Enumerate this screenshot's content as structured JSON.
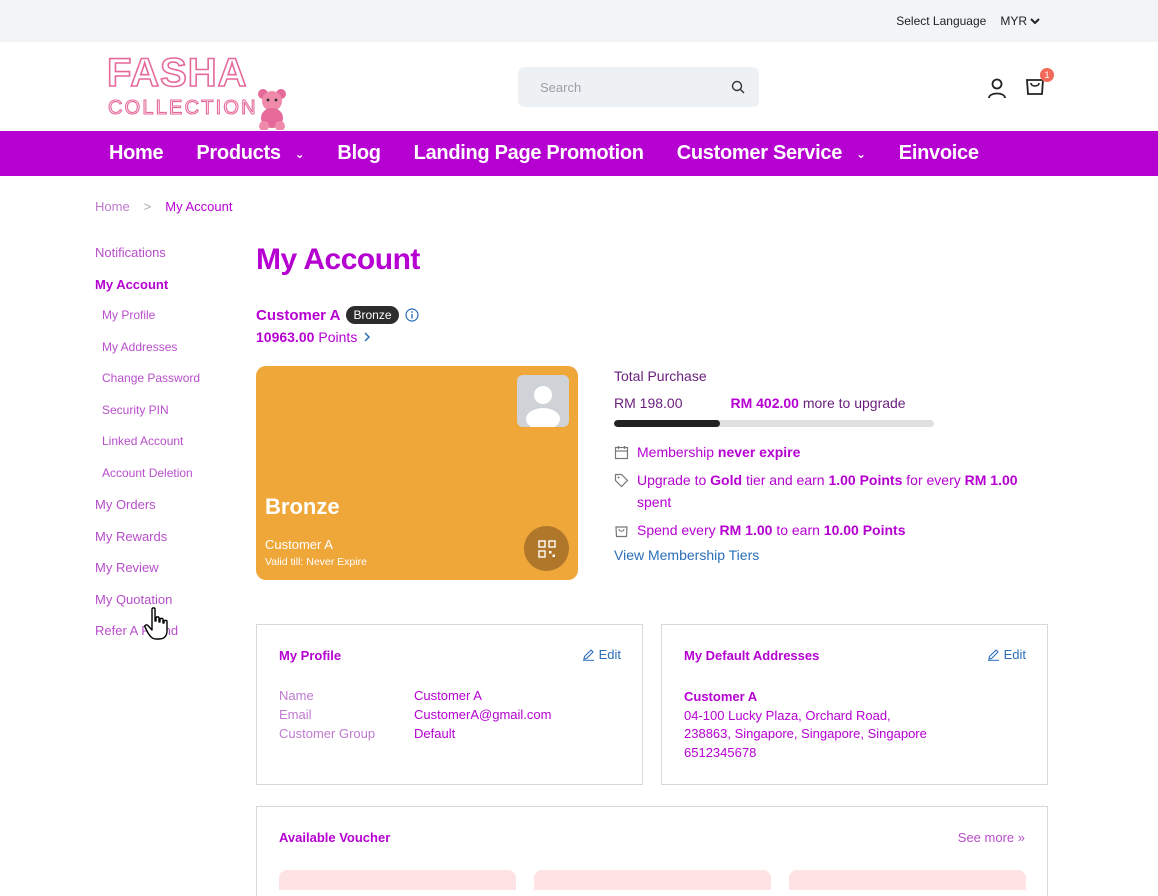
{
  "topbar": {
    "language_label": "Select Language",
    "currency": "MYR"
  },
  "header": {
    "logo_text_top": "FASHA",
    "logo_text_bottom": "COLLECTION",
    "search_placeholder": "Search",
    "cart_count": "1"
  },
  "nav": {
    "items": [
      {
        "label": "Home"
      },
      {
        "label": "Products"
      },
      {
        "label": "Blog"
      },
      {
        "label": "Landing Page Promotion"
      },
      {
        "label": "Customer Service"
      },
      {
        "label": "Einvoice"
      }
    ]
  },
  "breadcrumb": {
    "home": "Home",
    "separator": ">",
    "current": "My Account"
  },
  "sidebar": {
    "items": [
      {
        "label": "Notifications"
      },
      {
        "label": "My Account"
      },
      {
        "label": "My Profile"
      },
      {
        "label": "My Addresses"
      },
      {
        "label": "Change Password"
      },
      {
        "label": "Security PIN"
      },
      {
        "label": "Linked Account"
      },
      {
        "label": "Account Deletion"
      },
      {
        "label": "My Orders"
      },
      {
        "label": "My Rewards"
      },
      {
        "label": "My Review"
      },
      {
        "label": "My Quotation"
      },
      {
        "label": "Refer A Friend"
      }
    ]
  },
  "main": {
    "title": "My Account",
    "customer_name": "Customer A",
    "tier_badge": "Bronze",
    "points_value": "10963.00",
    "points_label": "Points",
    "card": {
      "tier": "Bronze",
      "name": "Customer A",
      "valid": "Valid till: Never Expire"
    },
    "tier_info": {
      "total_purchase_label": "Total Purchase",
      "current_amount": "RM 198.00",
      "upgrade_amount": "RM 402.00",
      "upgrade_suffix": "more to upgrade",
      "progress_fraction": 0.33,
      "membership_prefix": "Membership",
      "membership_value": "never expire",
      "upgrade_prefix": "Upgrade to",
      "upgrade_tier": "Gold",
      "upgrade_mid": "tier and earn",
      "upgrade_points": "1.00 Points",
      "upgrade_for": "for every",
      "upgrade_rm": "RM 1.00",
      "upgrade_spent": "spent",
      "spend_prefix": "Spend every",
      "spend_rm": "RM 1.00",
      "spend_mid": "to earn",
      "spend_points": "10.00 Points",
      "view_tiers": "View Membership Tiers"
    },
    "profile_card": {
      "title": "My Profile",
      "edit": "Edit",
      "rows": [
        {
          "label": "Name",
          "value": "Customer A"
        },
        {
          "label": "Email",
          "value": "CustomerA@gmail.com"
        },
        {
          "label": "Customer Group",
          "value": "Default"
        }
      ]
    },
    "address_card": {
      "title": "My Default Addresses",
      "edit": "Edit",
      "name": "Customer A",
      "line1": "04-100 Lucky Plaza, Orchard Road,",
      "line2": "238863, Singapore, Singapore, Singapore",
      "phone": "6512345678"
    },
    "voucher_card": {
      "title": "Available Voucher",
      "see_more": "See more"
    }
  },
  "colors": {
    "brand": "#b600d2",
    "card": "#f0a73a",
    "link": "#2a6eb8"
  }
}
